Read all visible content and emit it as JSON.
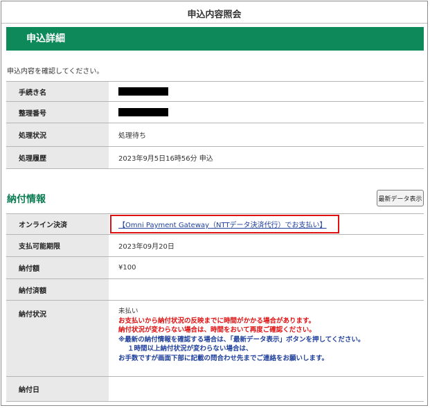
{
  "header": {
    "title": "申込内容照会"
  },
  "detail_section": {
    "title": "申込詳細",
    "instruction": "申込内容を確認してください。",
    "rows": [
      {
        "label": "手続き名",
        "value": ""
      },
      {
        "label": "整理番号",
        "value": ""
      },
      {
        "label": "処理状況",
        "value": "処理待ち"
      },
      {
        "label": "処理履歴",
        "value": "2023年9月5日16時56分 申込"
      }
    ]
  },
  "payment_section": {
    "title": "納付情報",
    "refresh_button": "最新データ表示",
    "online_payment": {
      "label": "オンライン決済",
      "link": "【Omni Payment Gateway（NTTデータ決済代行）でお支払い】"
    },
    "deadline": {
      "label": "支払可能期限",
      "value": "2023年09月20日"
    },
    "amount": {
      "label": "納付額",
      "value": "¥100"
    },
    "paid_amount": {
      "label": "納付済額",
      "value": ""
    },
    "status": {
      "label": "納付状況",
      "value": "未払い",
      "notes_red": [
        "お支払いから納付状況の反映までに時間がかかる場合があります。",
        "納付状況が変わらない場合は、時間をおいて再度ご確認ください。"
      ],
      "notes_blue": [
        "※最新の納付情報を確認する場合は、「最新データ表示」ボタンを押してください。",
        "１時間以上納付状況が変わらない場合は、",
        "お手数ですが画面下部に記載の問合わせ先までご連絡をお願いします。"
      ]
    },
    "payment_date": {
      "label": "納付日",
      "value": ""
    }
  },
  "colors": {
    "accent_green": "#0e8a5a",
    "alert_red": "#e01010",
    "link_blue": "#1e3f9c"
  }
}
